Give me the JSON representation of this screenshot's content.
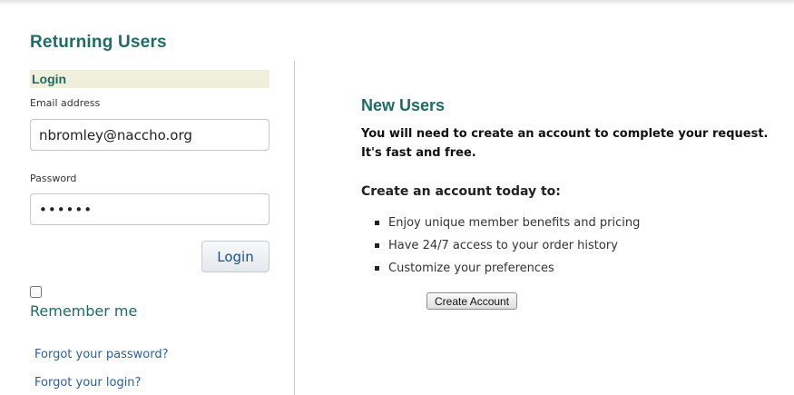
{
  "returning": {
    "title": "Returning Users",
    "login_header": "Login",
    "email_label": "Email address",
    "email_value": "nbromley@naccho.org",
    "password_label": "Password",
    "password_value": "••••••",
    "login_button": "Login",
    "remember_checked": false,
    "remember_label": "Remember me",
    "forgot_password": "Forgot your password?",
    "forgot_login": "Forgot your login?"
  },
  "new_users": {
    "title": "New Users",
    "intro_line1": "You will need to create an account to complete your request.",
    "intro_line2": "It's fast and free.",
    "cta_heading": "Create an account today to:",
    "benefits": [
      "Enjoy unique member benefits and pricing",
      "Have 24/7 access to your order history",
      "Customize your preferences"
    ],
    "create_button": "Create Account"
  },
  "colors": {
    "heading_teal": "#1f6b65",
    "link_blue": "#2a5fa0",
    "login_header_bg": "#efefdb"
  }
}
